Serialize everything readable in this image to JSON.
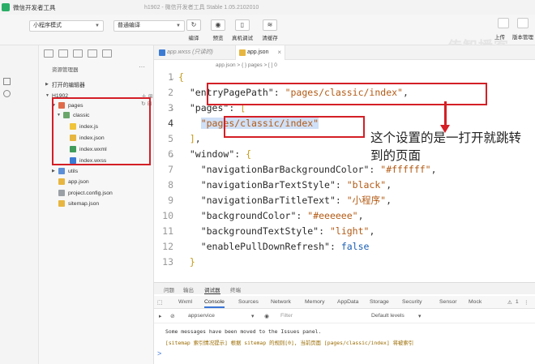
{
  "titlebar": {
    "app_title": "微信开发者工具",
    "window_title": "h1902 - 微信开发者工具 Stable 1.05.2102010"
  },
  "toolbar": {
    "mode_select": "小程序模式",
    "compile_select": "普通编译",
    "buttons": [
      {
        "label": "编译",
        "icon": "refresh-icon"
      },
      {
        "label": "预览",
        "icon": "eye-icon"
      },
      {
        "label": "真机调试",
        "icon": "phone-icon"
      },
      {
        "label": "清缓存",
        "icon": "layers-icon"
      }
    ],
    "right_buttons": [
      "上传",
      "版本管理"
    ],
    "watermark": "传智播客"
  },
  "explorer": {
    "header": "资源管理器",
    "open_editors": "打开的编辑器",
    "project": "H1902",
    "tree": [
      {
        "label": "pages",
        "type": "folder",
        "depth": 1
      },
      {
        "label": "classic",
        "type": "folder",
        "depth": 2
      },
      {
        "label": "index.js",
        "type": "js",
        "depth": 3
      },
      {
        "label": "index.json",
        "type": "json",
        "depth": 3
      },
      {
        "label": "index.wxml",
        "type": "wxml",
        "depth": 3
      },
      {
        "label": "index.wxss",
        "type": "wxss",
        "depth": 3
      },
      {
        "label": "utils",
        "type": "folder",
        "depth": 1
      },
      {
        "label": "app.json",
        "type": "json",
        "depth": 1
      },
      {
        "label": "project.config.json",
        "type": "cfg",
        "depth": 1
      },
      {
        "label": "sitemap.json",
        "type": "json",
        "depth": 1
      }
    ]
  },
  "editor": {
    "tabs": [
      {
        "label": "app.wxss (只读的)",
        "active": false
      },
      {
        "label": "app.json",
        "active": true
      }
    ],
    "breadcrumb": "app.json > { } pages > [ ] 0",
    "lines": [
      {
        "num": "1"
      },
      {
        "num": "2",
        "key": "\"entryPagePath\"",
        "value": "\"pages/classic/index\""
      },
      {
        "num": "3",
        "key": "\"pages\""
      },
      {
        "num": "4",
        "value": "\"pages/classic/index\""
      },
      {
        "num": "5"
      },
      {
        "num": "6",
        "key": "\"window\""
      },
      {
        "num": "7",
        "key": "\"navigationBarBackgroundColor\"",
        "value": "\"#ffffff\""
      },
      {
        "num": "8",
        "key": "\"navigationBarTextStyle\"",
        "value": "\"black\""
      },
      {
        "num": "9",
        "key": "\"navigationBarTitleText\"",
        "value": "\"小程序\""
      },
      {
        "num": "10",
        "key": "\"backgroundColor\"",
        "value": "\"#eeeeee\""
      },
      {
        "num": "11",
        "key": "\"backgroundTextStyle\"",
        "value": "\"light\""
      },
      {
        "num": "12",
        "key": "\"enablePullDownRefresh\"",
        "value": "false"
      },
      {
        "num": "13"
      }
    ]
  },
  "annotation": {
    "text": "这个设置的是一打开就跳转到的页面",
    "color": "#d41f26"
  },
  "panel": {
    "tabs": [
      "问题",
      "输出",
      "调试器",
      "终端"
    ],
    "active_tab": "调试器",
    "devtools_tabs": [
      "Wxml",
      "Console",
      "Sources",
      "Network",
      "Memory",
      "AppData",
      "Storage",
      "Security",
      "Sensor",
      "Mock"
    ],
    "active_devtool": "Console",
    "context": "appservice",
    "filter_placeholder": "Filter",
    "levels": "Default levels",
    "badge": "1",
    "messages": [
      "Some messages have been moved to the Issues panel.",
      "[sitemap 索引情况提示] 根据 sitemap 的规则[0], 当前页面 [pages/classic/index] 将被索引"
    ],
    "prompt": ">"
  }
}
